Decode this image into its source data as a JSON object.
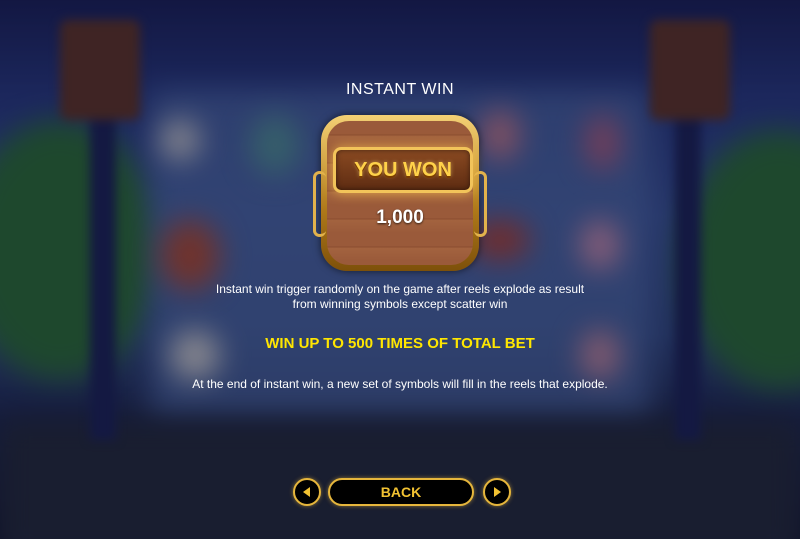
{
  "screen": {
    "title": "INSTANT WIN",
    "accent_color": "#ffe600",
    "gold_color": "#e6b63c"
  },
  "panel": {
    "banner_text": "YOU WON",
    "amount": "1,000"
  },
  "info": {
    "line1": "Instant win trigger randomly on the game after reels explode as result",
    "line2": "from winning symbols except scatter win",
    "highlight": "WIN UP TO 500 TIMES OF TOTAL BET",
    "line3": "At the end of instant win, a new set of symbols will fill in the reels that explode."
  },
  "nav": {
    "back_label": "BACK",
    "prev_icon": "triangle-left-icon",
    "next_icon": "triangle-right-icon"
  }
}
